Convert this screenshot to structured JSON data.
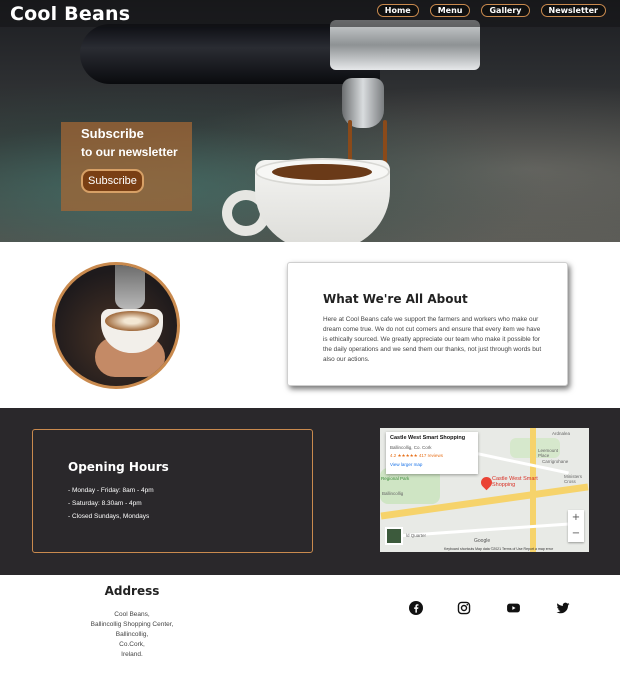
{
  "header": {
    "brand": "Cool Beans",
    "nav": [
      "Home",
      "Menu",
      "Gallery",
      "Newsletter"
    ]
  },
  "hero": {
    "subscribe_title": "Subscribe",
    "subscribe_subtitle": "to our newsletter",
    "subscribe_button": "Subscribe"
  },
  "about": {
    "title": "What We're All About",
    "text": "Here at Cool Beans cafe we support the farmers and workers who make our dream come true. We do not cut corners and ensure that every item we have is ethically sourced. We greatly appreciate our team who make it possible for the daily operations and we send them our thanks, not just through words but also our actions."
  },
  "hours": {
    "title": "Opening Hours",
    "items": [
      "- Monday - Friday: 8am - 4pm",
      "- Saturday: 8.30am - 4pm",
      "- Closed Sundays, Mondays"
    ]
  },
  "map": {
    "place_name": "Castle West Smart Shopping",
    "place_address": "Ballincollig, Co. Cork",
    "rating": "4.2 ★★★★★  417 reviews",
    "larger_map": "View larger map",
    "pin_label": "Castle West Smart Shopping",
    "places": [
      "Ardnalea",
      "Leemount Place",
      "Carrigrohane",
      "Ministers Cross",
      "Regional Park",
      "Ballincollig",
      "ld Quarter"
    ],
    "zoom_in": "+",
    "zoom_out": "−",
    "google": "Google",
    "footer": "Keyboard shortcuts   Map data ©2021   Terms of Use   Report a map error"
  },
  "footer": {
    "address_title": "Address",
    "address_lines": [
      "Cool Beans,",
      "Ballincollig Shopping Center,",
      "Ballincollig,",
      "Co.Cork,",
      "Ireland."
    ]
  },
  "social": [
    "facebook-icon",
    "instagram-icon",
    "youtube-icon",
    "twitter-icon"
  ],
  "colors": {
    "accent": "#c98a4e",
    "dark_band": "#2a282b",
    "subscribe_overlay": "#a66834"
  }
}
